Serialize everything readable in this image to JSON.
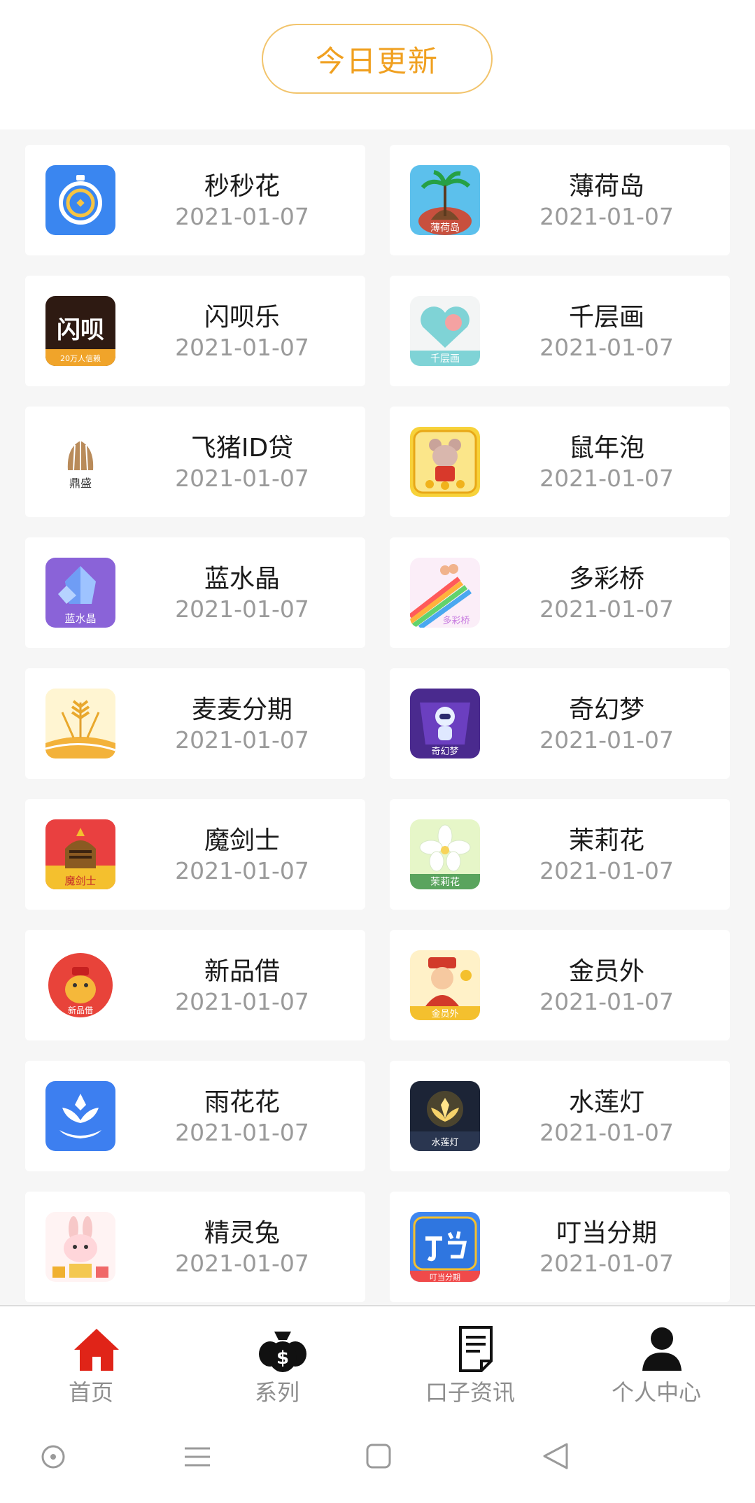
{
  "header": {
    "today_label": "今日更新"
  },
  "apps": [
    {
      "name": "秒秒花",
      "date": "2021-01-07",
      "icon": "stopwatch-icon"
    },
    {
      "name": "薄荷岛",
      "date": "2021-01-07",
      "icon": "palm-island-icon"
    },
    {
      "name": "闪呗乐",
      "date": "2021-01-07",
      "icon": "shanbei-logo-icon",
      "icon_text": "闪呗",
      "icon_sub": "20万人信赖"
    },
    {
      "name": "千层画",
      "date": "2021-01-07",
      "icon": "heart-balloon-icon"
    },
    {
      "name": "飞猪ID贷",
      "date": "2021-01-07",
      "icon": "dingsheng-logo-icon",
      "icon_text": "鼎盛"
    },
    {
      "name": "鼠年泡",
      "date": "2021-01-07",
      "icon": "rat-year-icon"
    },
    {
      "name": "蓝水晶",
      "date": "2021-01-07",
      "icon": "crystal-icon",
      "icon_text": "蓝水晶"
    },
    {
      "name": "多彩桥",
      "date": "2021-01-07",
      "icon": "rainbow-bridge-icon"
    },
    {
      "name": "麦麦分期",
      "date": "2021-01-07",
      "icon": "wheat-icon"
    },
    {
      "name": "奇幻梦",
      "date": "2021-01-07",
      "icon": "robot-icon"
    },
    {
      "name": "魔剑士",
      "date": "2021-01-07",
      "icon": "knight-helmet-icon",
      "icon_text": "魔剑士"
    },
    {
      "name": "茉莉花",
      "date": "2021-01-07",
      "icon": "jasmine-flower-icon",
      "icon_text": "茉莉花"
    },
    {
      "name": "新品借",
      "date": "2021-01-07",
      "icon": "lucky-cat-icon"
    },
    {
      "name": "金员外",
      "date": "2021-01-07",
      "icon": "fortune-god-icon"
    },
    {
      "name": "雨花花",
      "date": "2021-01-07",
      "icon": "lotus-hand-icon"
    },
    {
      "name": "水莲灯",
      "date": "2021-01-07",
      "icon": "lotus-lamp-icon"
    },
    {
      "name": "精灵兔",
      "date": "2021-01-07",
      "icon": "bunny-icon"
    },
    {
      "name": "叮当分期",
      "date": "2021-01-07",
      "icon": "dingdang-logo-icon"
    }
  ],
  "tabbar": [
    {
      "label": "首页",
      "icon": "home-icon",
      "active": true
    },
    {
      "label": "系列",
      "icon": "money-bags-icon",
      "active": false
    },
    {
      "label": "口子资讯",
      "icon": "document-icon",
      "active": false
    },
    {
      "label": "个人中心",
      "icon": "user-icon",
      "active": false
    }
  ],
  "colors": {
    "accent": "#f0a020",
    "home_active": "#e02418",
    "date_gray": "#9a9a9a"
  }
}
